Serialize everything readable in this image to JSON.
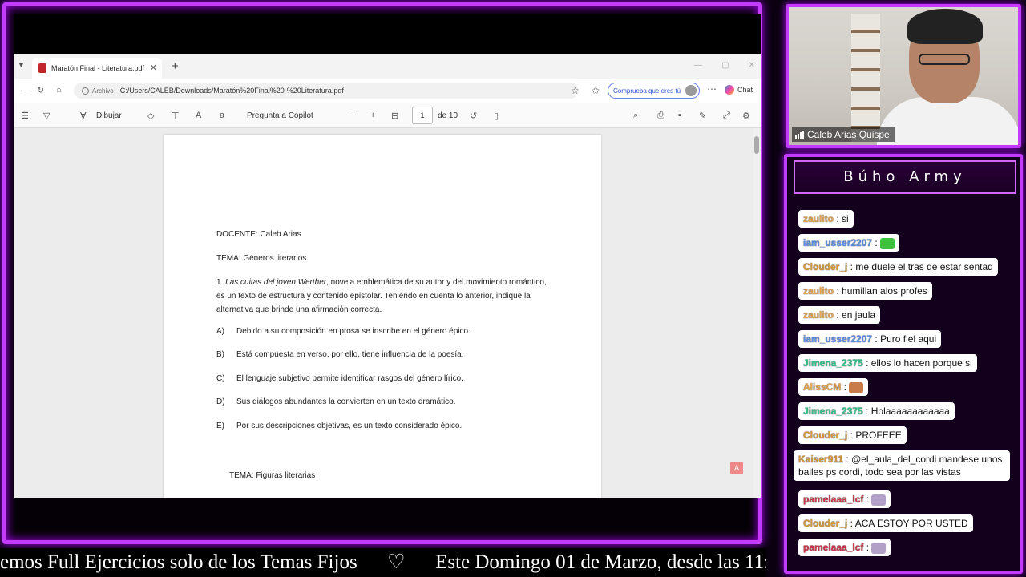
{
  "browser": {
    "tab_title": "Maratón Final - Literatura.pdf",
    "address_prefix": "Archivo",
    "url": "C:/Users/CALEB/Downloads/Maratón%20Final%20-%20Literatura.pdf",
    "check_label": "Comprueba que eres tú",
    "chat_label": "Chat"
  },
  "pdf_toolbar": {
    "draw_label": "Dibujar",
    "copilot_label": "Pregunta a Copilot",
    "page_current": "1",
    "page_total": "de 10"
  },
  "document": {
    "docente": "DOCENTE: Caleb Arias",
    "tema1": "TEMA: Géneros literarios",
    "q1_italic": "Las cuitas del joven Werther",
    "q1_rest": ", novela emblemática de su autor y del movimiento romántico, es un texto de estructura y contenido epistolar. Teniendo en cuenta lo anterior, indique la alternativa que brinde una afirmación correcta.",
    "q1_number": "1.",
    "options": [
      {
        "letter": "A)",
        "text": "Debido a su composición en prosa se inscribe en el género épico."
      },
      {
        "letter": "B)",
        "text": "Está compuesta en verso, por ello, tiene influencia de la poesía."
      },
      {
        "letter": "C)",
        "text": "El lenguaje subjetivo permite identificar rasgos del género lírico."
      },
      {
        "letter": "D)",
        "text": "Sus diálogos abundantes la convierten en un texto dramático."
      },
      {
        "letter": "E)",
        "text": "Por sus descripciones objetivas, es un texto considerado épico."
      }
    ],
    "tema2": "TEMA: Figuras literarias"
  },
  "ticker": {
    "text": "emos Full Ejercicios solo de los Temas Fijos      ♡      Este Domingo 01 de Marzo, desde las 11:"
  },
  "camera": {
    "name": "Caleb Arias Quispe"
  },
  "chat": {
    "title": "Búho Army",
    "messages": [
      {
        "user": "zaulito",
        "text": "si",
        "color": "#e7a64c"
      },
      {
        "user": "iam_usser2207",
        "text": "",
        "color": "#5b8ee6",
        "emote": "#3ec23e"
      },
      {
        "user": "Clouder_j",
        "text": "me duele el tras de estar sentad",
        "color": "#d99b3a"
      },
      {
        "user": "zaulito",
        "text": "humillan alos profes",
        "color": "#e7a64c"
      },
      {
        "user": "zaulito",
        "text": "en jaula",
        "color": "#e7a64c"
      },
      {
        "user": "iam_usser2207",
        "text": "Puro fiel aqui",
        "color": "#5b8ee6"
      },
      {
        "user": "Jimena_2375",
        "text": "ellos lo hacen porque si",
        "color": "#35c48c"
      },
      {
        "user": "AlissCM",
        "text": "",
        "color": "#e7a64c",
        "emote": "#c97b4a"
      },
      {
        "user": "Jimena_2375",
        "text": "Holaaaaaaaaaaaa",
        "color": "#35c48c"
      },
      {
        "user": "Clouder_j",
        "text": "PROFEEE",
        "color": "#d99b3a"
      },
      {
        "user": "Kaiser911",
        "text": "@el_aula_del_cordi mandese unos bailes ps cordi, todo sea por las vistas",
        "color": "#d99b3a"
      },
      {
        "user": "pamelaaa_lcf",
        "text": "",
        "color": "#d0354b",
        "emote": "#b3a0c7"
      },
      {
        "user": "Clouder_j",
        "text": "ACA ESTOY POR USTED",
        "color": "#d99b3a"
      },
      {
        "user": "pamelaaa_lcf",
        "text": "",
        "color": "#d0354b",
        "emote": "#b3a0c7"
      }
    ]
  }
}
